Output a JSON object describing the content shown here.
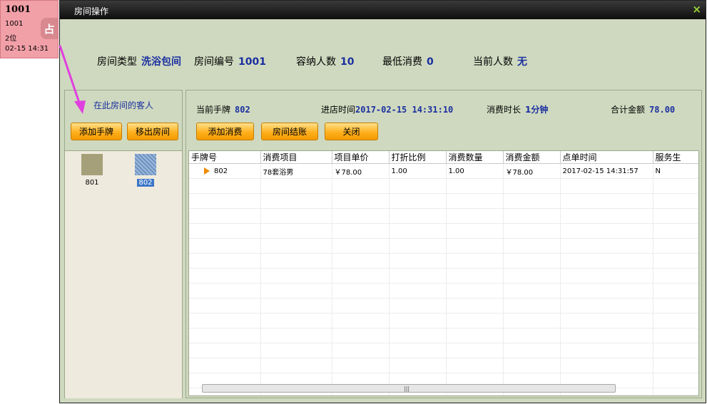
{
  "room_tile": {
    "number": "1001",
    "line1": "1001",
    "line2": "2位",
    "line3": "02-15 14:31",
    "badge": "占",
    "color": "#f2a0a8"
  },
  "dialog": {
    "title": "房间操作",
    "close": "×"
  },
  "room_info": {
    "type_label": "房间类型",
    "type_value": "洗浴包间",
    "number_label": "房间编号",
    "number_value": "1001",
    "capacity_label": "容纳人数",
    "capacity_value": "10",
    "min_label": "最低消费",
    "min_value": "0",
    "current_label": "当前人数",
    "current_value": "无"
  },
  "left_panel": {
    "title": "在此房间的客人",
    "add_tag_button": "添加手牌",
    "remove_button": "移出房间",
    "guests": [
      {
        "id": "801",
        "color": "#a6a07a",
        "selected": false
      },
      {
        "id": "802",
        "color": "#7f9fc6",
        "selected": true
      }
    ]
  },
  "bill": {
    "tag_label": "当前手牌",
    "tag_value": "802",
    "checkin_label": "进店时间",
    "checkin_value": "2017-02-15 14:31:10",
    "duration_label": "消费时长",
    "duration_value": "1分钟",
    "total_label": "合计金额",
    "total_value": "78.00",
    "add_consume_button": "添加消费",
    "checkout_button": "房间结账",
    "close_button": "关闭"
  },
  "grid": {
    "columns": [
      "手牌号",
      "消费项目",
      "项目单价",
      "打折比例",
      "消费数量",
      "消费金额",
      "点单时间",
      "服务生"
    ],
    "rows": [
      {
        "tag": "802",
        "item": "78套浴男",
        "price": "￥78.00",
        "discount": "1.00",
        "qty": "1.00",
        "amount": "￥78.00",
        "time": "2017-02-15 14:31:57",
        "waiter": "N"
      }
    ],
    "scroll_grip": "|||"
  },
  "colors": {
    "dialog_bg": "#cfd9bf",
    "accent_blue": "#1a2fa0",
    "button_orange": "#ffb01e",
    "annotation_pink": "#e040e0"
  }
}
